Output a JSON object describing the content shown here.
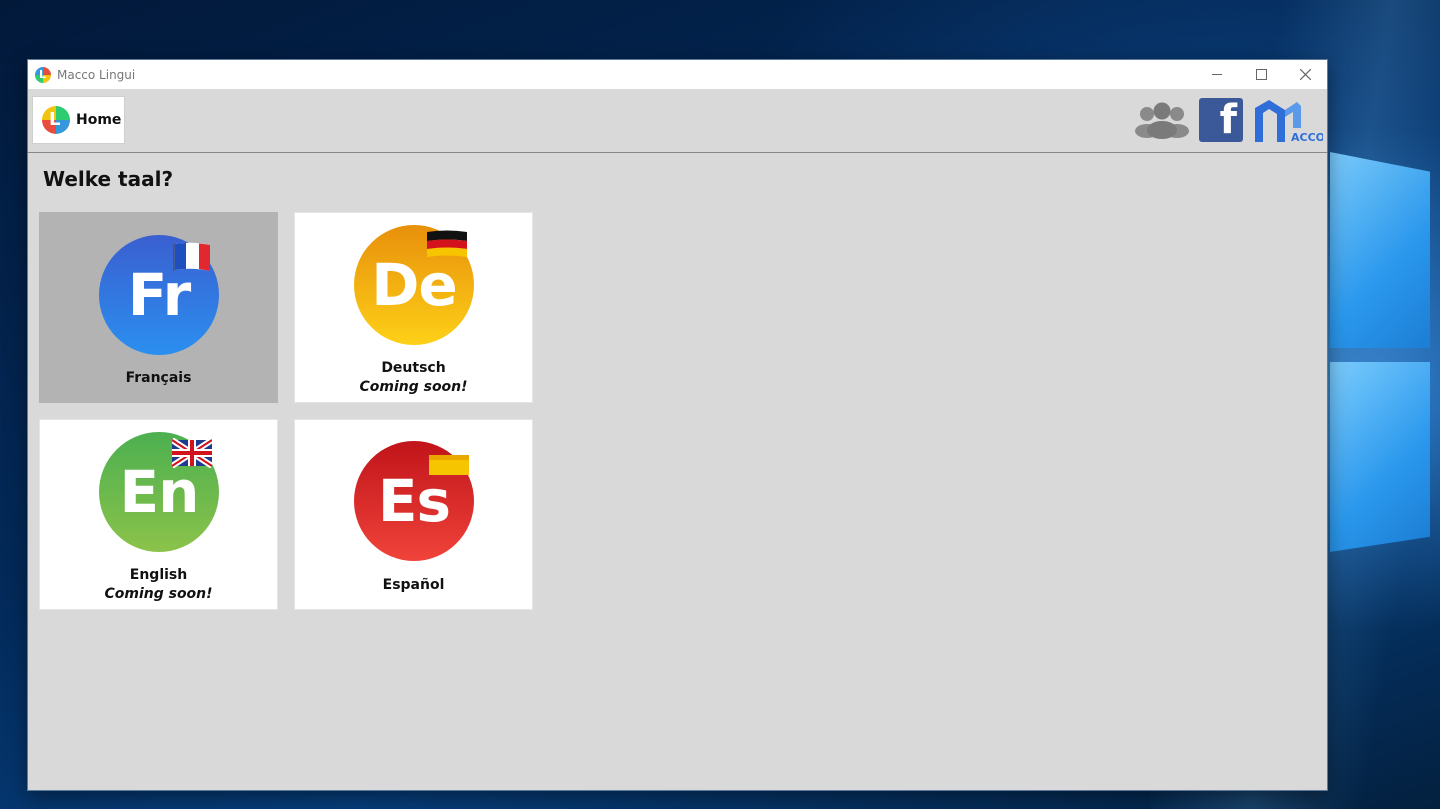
{
  "window": {
    "title": "Macco Lingui"
  },
  "toolbar": {
    "home_label": "Home",
    "logo_letter": "L"
  },
  "page": {
    "title": "Welke taal?"
  },
  "languages": [
    {
      "code": "Fr",
      "name": "Français",
      "status": "",
      "selected": true,
      "color_from": "#3a5fd0",
      "color_to": "#2b8ff0"
    },
    {
      "code": "De",
      "name": "Deutsch",
      "status": "Coming soon!",
      "selected": false,
      "color_from": "#e8900c",
      "color_to": "#fdd017"
    },
    {
      "code": "En",
      "name": "English",
      "status": "Coming soon!",
      "selected": false,
      "color_from": "#4caf50",
      "color_to": "#8bc34a"
    },
    {
      "code": "Es",
      "name": "Español",
      "status": "",
      "selected": false,
      "color_from": "#c0141a",
      "color_to": "#f0433a"
    }
  ],
  "icons": {
    "users": "users-group-icon",
    "facebook": "facebook-icon",
    "macco": "macco-logo-icon"
  },
  "brand_text": "ACCO"
}
